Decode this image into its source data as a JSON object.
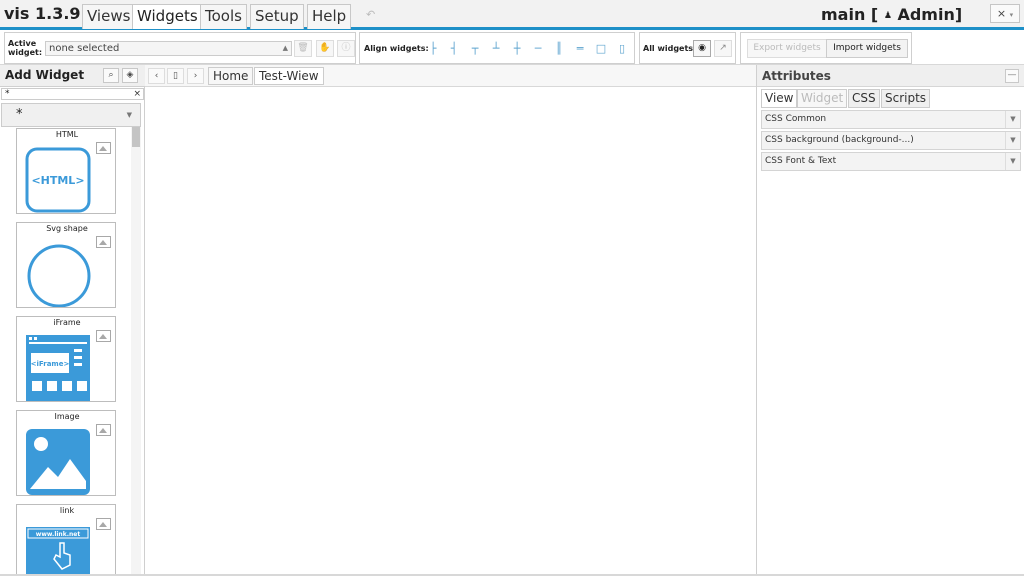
{
  "app": {
    "title": "vis 1.3.9",
    "project": "main [",
    "user": "Admin]",
    "close_label": "×",
    "undo_label": "↶"
  },
  "menu": {
    "tabs": [
      {
        "label": "Views"
      },
      {
        "label": "Widgets"
      },
      {
        "label": "Tools"
      },
      {
        "label": "Setup"
      },
      {
        "label": "Help"
      }
    ]
  },
  "toolbar": {
    "active_widget_label_1": "Active",
    "active_widget_label_2": "widget:",
    "active_widget_value": "none selected",
    "align_label": "Align widgets:",
    "all_widgets_label": "All widgets:",
    "export_label": "Export widgets",
    "import_label": "Import widgets"
  },
  "add_widget": {
    "title": "Add Widget",
    "filter_value": "*",
    "filter_clear": "×",
    "set_value": "*",
    "widgets": [
      {
        "name": "HTML",
        "preview_text": "<HTML>"
      },
      {
        "name": "Svg shape"
      },
      {
        "name": "iFrame",
        "preview_text": "<iFrame>"
      },
      {
        "name": "Image"
      },
      {
        "name": "link",
        "preview_text": "www.link.net"
      }
    ]
  },
  "views": {
    "tabs": [
      {
        "label": "Home"
      },
      {
        "label": "Test-Wiew"
      }
    ]
  },
  "attributes": {
    "title": "Attributes",
    "tabs": [
      {
        "label": "View"
      },
      {
        "label": "Widget"
      },
      {
        "label": "CSS"
      },
      {
        "label": "Scripts"
      }
    ],
    "groups": [
      {
        "label": "CSS Common"
      },
      {
        "label": "CSS background (background-...)"
      },
      {
        "label": "CSS Font & Text"
      }
    ]
  },
  "colors": {
    "accent": "#1e90c8",
    "widget_icon": "#3b9ad9"
  }
}
